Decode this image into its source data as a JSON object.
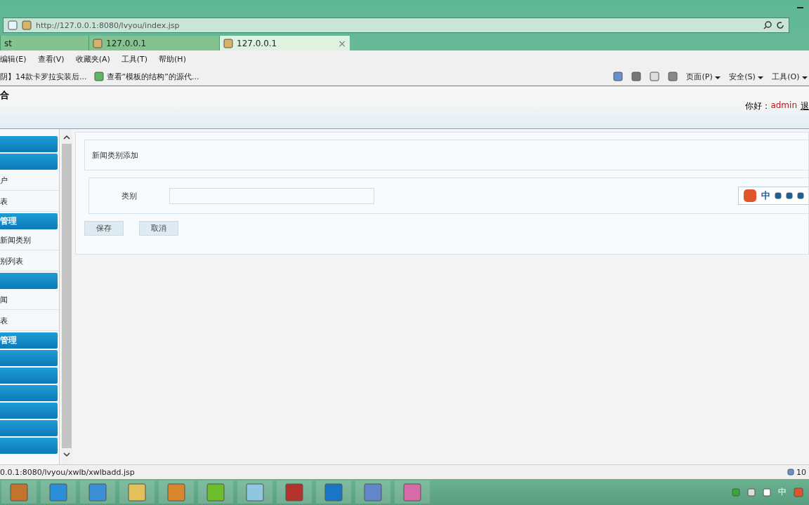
{
  "browser": {
    "address": "http://127.0.0.1:8080/lvyou/index.jsp",
    "tabs": [
      {
        "label": "st",
        "selected": false
      },
      {
        "label": "127.0.0.1",
        "selected": false
      },
      {
        "label": "127.0.0.1",
        "selected": true
      }
    ],
    "tab_close": "×",
    "menu": [
      "编辑(E)",
      "查看(V)",
      "收藏夹(A)",
      "工具(T)",
      "帮助(H)"
    ],
    "favorites": [
      "阴】14款卡罗拉实装后...",
      "查看“模板的结构”的源代..."
    ],
    "command_bar": [
      "页面(P)",
      "安全(S)",
      "工具(O)"
    ]
  },
  "header": {
    "logo_fragment": "合",
    "greeting": "你好：",
    "user": "admin",
    "logout": "退"
  },
  "sidebar": [
    {
      "kind": "header"
    },
    {
      "kind": "header"
    },
    {
      "kind": "link",
      "label": "户"
    },
    {
      "kind": "link",
      "label": "表"
    },
    {
      "kind": "header",
      "label": "管理"
    },
    {
      "kind": "link",
      "label": "新闻类别"
    },
    {
      "kind": "link",
      "label": "别列表"
    },
    {
      "kind": "header"
    },
    {
      "kind": "link",
      "label": "闻"
    },
    {
      "kind": "link",
      "label": "表"
    },
    {
      "kind": "header",
      "label": "管理"
    },
    {
      "kind": "header"
    },
    {
      "kind": "header"
    },
    {
      "kind": "header"
    },
    {
      "kind": "header"
    },
    {
      "kind": "header"
    },
    {
      "kind": "header"
    }
  ],
  "form": {
    "title": "新闻类别添加",
    "field_label": "类别",
    "buttons": [
      "保存",
      "取消"
    ],
    "ime": "中"
  },
  "status_bar": {
    "url": "0.0.1:8080/lvyou/xwlb/xwlbadd.jsp",
    "zoom": "10"
  },
  "tray": {
    "ime": "中"
  }
}
